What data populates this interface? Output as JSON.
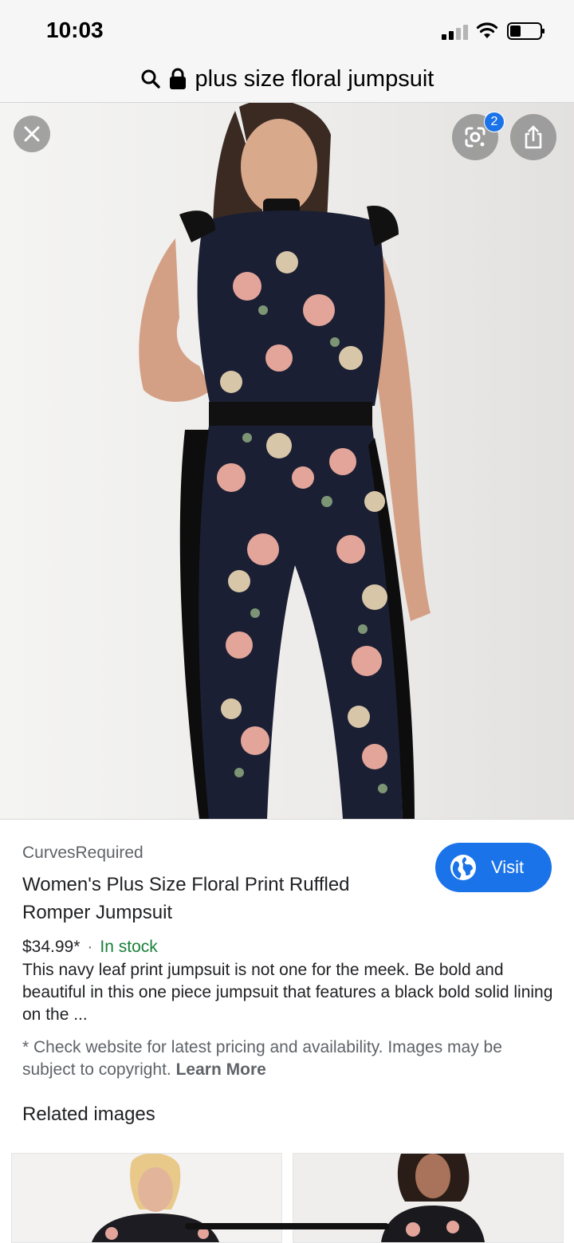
{
  "status_bar": {
    "time": "10:03"
  },
  "url_bar": {
    "query": "plus size floral jumpsuit"
  },
  "image_viewer": {
    "lens_badge_count": "2"
  },
  "product": {
    "source": "CurvesRequired",
    "title": "Women's Plus Size Floral Print Ruffled Romper Jumpsuit",
    "price": "$34.99*",
    "price_separator": "·",
    "availability": "In stock",
    "description": "This navy leaf print jumpsuit is not one for the meek. Be bold and beautiful in this one piece jumpsuit that features a black bold solid lining on the ...",
    "disclaimer": "* Check website for latest pricing and availability. Images may be subject to copyright.",
    "learn_more": "Learn More",
    "visit_label": "Visit"
  },
  "related": {
    "heading": "Related images"
  },
  "colors": {
    "accent": "#1a73e8",
    "in_stock": "#188038",
    "secondary_text": "#5f6368"
  },
  "icons": [
    "search-icon",
    "lock-icon",
    "close-icon",
    "lens-icon",
    "share-icon",
    "globe-icon",
    "signal-icon",
    "wifi-icon",
    "battery-icon"
  ]
}
